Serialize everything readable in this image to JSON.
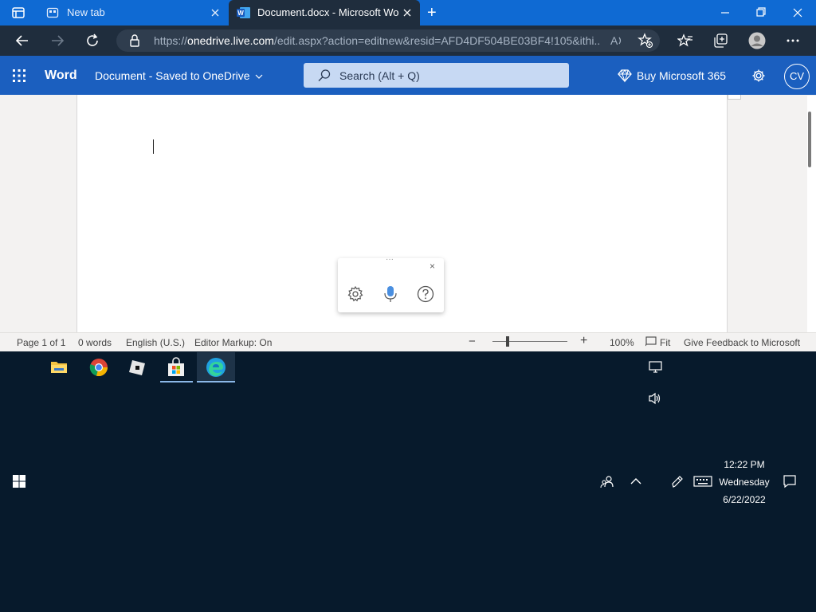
{
  "browser": {
    "tabs": [
      {
        "label": "New tab"
      },
      {
        "label": "Document.docx - Microsoft Word Online"
      }
    ],
    "new_tab_symbol": "+",
    "url": {
      "scheme": "https://",
      "domain": "onedrive.live.com",
      "path": "/edit.aspx?action=editnew&resid=AFD4DF504BE03BF4!105&ithi..."
    }
  },
  "word": {
    "app_name": "Word",
    "doc_title": "Document  -  Saved to OneDrive",
    "search_placeholder": "Search (Alt + Q)",
    "buy_label": "Buy Microsoft 365",
    "avatar_initials": "CV"
  },
  "dictation": {
    "grip": "···",
    "close": "×"
  },
  "statusbar": {
    "page": "Page 1 of 1",
    "words": "0 words",
    "language": "English (U.S.)",
    "editor_markup": "Editor Markup: On",
    "zoom_minus": "−",
    "zoom_plus": "+",
    "zoom_level": "100%",
    "zoom_fraction": 0.2,
    "fit": "Fit",
    "feedback": "Give Feedback to Microsoft"
  },
  "taskbar": {
    "time": "12:22 PM",
    "day": "Wednesday",
    "date": "6/22/2022"
  },
  "colors": {
    "tabbar": "#0f6ad3",
    "browser_chrome": "#1f2d3d",
    "word_header": "#1b5fbf",
    "desktop": "#071a2c"
  }
}
